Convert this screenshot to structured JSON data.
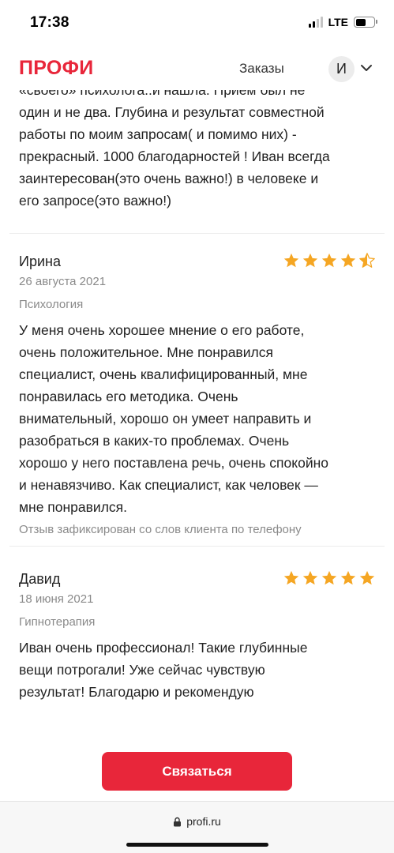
{
  "status_bar": {
    "time": "17:38",
    "network": "LTE",
    "battery_level": 0.55
  },
  "header": {
    "logo": "ПРОФИ",
    "nav_orders": "Заказы",
    "avatar_initial": "И",
    "brand_color": "#e8263a"
  },
  "previous_review": {
    "lines": [
      "«своего» психолога..и нашла. Прием был не",
      "один и не два. Глубина и результат совместной",
      "работы по моим запросам( и помимо них) -",
      "прекрасный. 1000 благодарностей ! Иван всегда",
      "заинтересован(это очень важно!) в человеке и",
      "его запросе(это важно!)"
    ]
  },
  "reviews": [
    {
      "name": "Ирина",
      "date": "26 августа 2021",
      "category": "Психология",
      "rating": 4.5,
      "lines": [
        "У меня очень хорошее мнение о его работе,",
        "очень положительное. Мне понравился",
        "специалист, очень квалифицированный, мне",
        "понравилась его методика. Очень",
        "внимательный, хорошо он умеет направить и",
        "разобраться в каких-то проблемах. Очень",
        "хорошо у него поставлена речь, очень спокойно",
        "и ненавязчиво. Как специалист, как человек —",
        "мне понравился."
      ],
      "note": "Отзыв зафиксирован со слов клиента по телефону"
    },
    {
      "name": "Давид",
      "date": "18 июня 2021",
      "category": "Гипнотерапия",
      "rating": 5,
      "lines": [
        "Иван очень профессионал! Такие глубинные",
        "вещи потрогали! Уже сейчас чувствую",
        "результат! Благодарю и рекомендую"
      ]
    }
  ],
  "cta": {
    "label": "Связаться"
  },
  "browser": {
    "url": "profi.ru"
  },
  "icons": {
    "star": "star-icon",
    "chevron": "chevron-down-icon",
    "lock": "lock-icon"
  },
  "colors": {
    "star": "#f5a623",
    "cta": "#e8263a",
    "muted_text": "#8a8a8a"
  }
}
